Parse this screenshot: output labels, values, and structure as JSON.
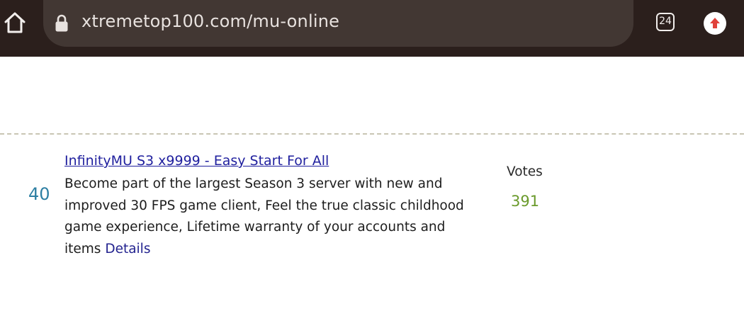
{
  "browser": {
    "url": "xtremetop100.com/mu-online",
    "tab_count": "24",
    "icons": {
      "home": "home-icon",
      "lock": "lock-icon",
      "tabs": "tabs-icon",
      "update": "update-arrow-icon"
    },
    "colors": {
      "toolbar_bg": "#2b1f1c",
      "urlbar_bg": "#423733",
      "update_arrow": "#e0413a"
    }
  },
  "listing": {
    "rank": "40",
    "title": "InfinityMU S3 x9999 - Easy Start For All",
    "description": "Become part of the largest Season 3 server with new and improved 30 FPS game client, Feel the true classic childhood game experience, Lifetime warranty of your accounts and items",
    "details_label": "Details",
    "votes_label": "Votes",
    "votes_count": "391",
    "colors": {
      "rank": "#2d7fa3",
      "title_link": "#1f1f9e",
      "votes_count": "#6a9a2b"
    }
  }
}
